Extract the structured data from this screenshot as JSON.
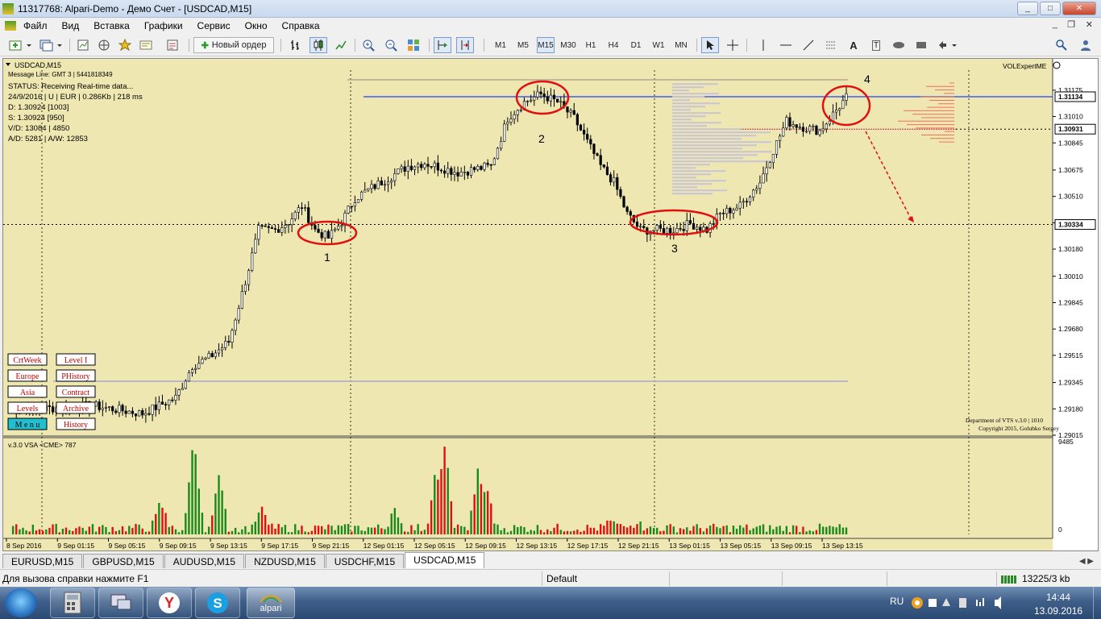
{
  "window": {
    "title": "11317768: Alpari-Demo - Демо Счет - [USDCAD,M15]",
    "buttons": [
      "_",
      "□",
      "✕"
    ]
  },
  "menu": [
    "Файл",
    "Вид",
    "Вставка",
    "Графики",
    "Сервис",
    "Окно",
    "Справка"
  ],
  "toolbar": {
    "new_order_label": "Новый ордер",
    "timeframes": [
      "M1",
      "M5",
      "M15",
      "M30",
      "H1",
      "H4",
      "D1",
      "W1",
      "MN"
    ],
    "active_timeframe": "M15"
  },
  "chart": {
    "symbol_title": "USDCAD,M15",
    "info_lines": [
      "Message Line: GMT 3 | 5441818349",
      "STATUS:  Receiving Real-time data...",
      "24/9/2016 | U | EUR | 0.286Kb | 218 ms",
      "D: 1.30924  [1003]",
      "S: 1.30924  [950]",
      "V/D: 13084 | 4850",
      "A/D: 5281 | A/W: 12853"
    ],
    "expert_label": "VOLExpertME",
    "copyright_lines": [
      "Department of VTS  v.3.0 | 1010",
      "Copyright 2015, Golubko Sergey"
    ],
    "side_buttons": [
      [
        "CrtWeek",
        "Level I"
      ],
      [
        "Europe",
        "PHistory"
      ],
      [
        "Asia",
        "Contract"
      ],
      [
        "Levels",
        "Archive"
      ],
      [
        "M e n u",
        "History"
      ]
    ],
    "annotations": [
      "1",
      "2",
      "3",
      "4"
    ],
    "indicator_label": "v.3.0 VSA <CME> 787"
  },
  "chart_data": {
    "type": "candlestick",
    "symbol": "USDCAD",
    "timeframe": "M15",
    "y_ticks": [
      "1.31175",
      "1.31010",
      "1.30845",
      "1.30675",
      "1.30510",
      "1.30345",
      "1.30180",
      "1.30010",
      "1.29845",
      "1.29680",
      "1.29515",
      "1.29345",
      "1.29180",
      "1.29015"
    ],
    "ylim": [
      1.2902,
      1.3125
    ],
    "price_labels": [
      "1.31134",
      "1.30931",
      "1.30334"
    ],
    "highlight_prices": {
      "blue": 1.31134,
      "red_dots": 1.30931,
      "black_dots": 1.30334
    },
    "x_ticks": [
      "8 Sep 2016",
      "9 Sep 01:15",
      "9 Sep 05:15",
      "9 Sep 09:15",
      "9 Sep 13:15",
      "9 Sep 17:15",
      "9 Sep 21:15",
      "12 Sep 01:15",
      "12 Sep 05:15",
      "12 Sep 09:15",
      "12 Sep 13:15",
      "12 Sep 17:15",
      "12 Sep 21:15",
      "13 Sep 01:15",
      "13 Sep 05:15",
      "13 Sep 09:15",
      "13 Sep 13:15"
    ],
    "close_path": [
      [
        1.2917,
        0
      ],
      [
        1.292,
        25
      ],
      [
        1.2915,
        40
      ],
      [
        1.2925,
        50
      ],
      [
        1.2945,
        55
      ],
      [
        1.295,
        60
      ],
      [
        1.296,
        66
      ],
      [
        1.299,
        70
      ],
      [
        1.303,
        75
      ],
      [
        1.303,
        80
      ],
      [
        1.3035,
        84
      ],
      [
        1.3045,
        88
      ],
      [
        1.303,
        92
      ],
      [
        1.3025,
        96
      ],
      [
        1.3035,
        100
      ],
      [
        1.305,
        104
      ],
      [
        1.3055,
        108
      ],
      [
        1.306,
        112
      ],
      [
        1.307,
        120
      ],
      [
        1.3072,
        125
      ],
      [
        1.3066,
        135
      ],
      [
        1.307,
        145
      ],
      [
        1.31,
        150
      ],
      [
        1.311,
        155
      ],
      [
        1.3115,
        160
      ],
      [
        1.311,
        165
      ],
      [
        1.31,
        170
      ],
      [
        1.3085,
        174
      ],
      [
        1.307,
        178
      ],
      [
        1.306,
        182
      ],
      [
        1.304,
        186
      ],
      [
        1.303,
        190
      ],
      [
        1.303,
        200
      ],
      [
        1.3034,
        205
      ],
      [
        1.303,
        210
      ],
      [
        1.304,
        214
      ],
      [
        1.3045,
        220
      ],
      [
        1.306,
        226
      ],
      [
        1.308,
        230
      ],
      [
        1.3098,
        234
      ],
      [
        1.3095,
        238
      ],
      [
        1.3092,
        244
      ],
      [
        1.3105,
        249
      ],
      [
        1.3113,
        252
      ]
    ],
    "volume_ylim": [
      0,
      9485
    ],
    "volume_labels": [
      "9485",
      "0"
    ],
    "volume_spikes": [
      {
        "pos": 0.18,
        "v": 3200,
        "c": "red"
      },
      {
        "pos": 0.22,
        "v": 9200,
        "c": "green"
      },
      {
        "pos": 0.25,
        "v": 5500,
        "c": "red"
      },
      {
        "pos": 0.3,
        "v": 2400,
        "c": "red"
      },
      {
        "pos": 0.46,
        "v": 2100,
        "c": "green"
      },
      {
        "pos": 0.52,
        "v": 9000,
        "c": "red"
      },
      {
        "pos": 0.51,
        "v": 6500,
        "c": "red"
      },
      {
        "pos": 0.56,
        "v": 6300,
        "c": "green"
      },
      {
        "pos": 0.57,
        "v": 4500,
        "c": "green"
      },
      {
        "pos": 0.72,
        "v": 1400,
        "c": "green"
      },
      {
        "pos": 0.75,
        "v": 900,
        "c": "red"
      }
    ]
  },
  "tabs": [
    "EURUSD,M15",
    "GBPUSD,M15",
    "AUDUSD,M15",
    "NZDUSD,M15",
    "USDCHF,M15",
    "USDCAD,M15"
  ],
  "active_tab": "USDCAD,M15",
  "status": {
    "help": "Для вызова справки нажмите F1",
    "profile": "Default",
    "traffic": "13225/3 kb"
  },
  "taskbar": {
    "lang": "RU",
    "time": "14:44",
    "date": "13.09.2016",
    "alpari_label": "alpari"
  },
  "colors": {
    "chart_bg": "#efe7b2",
    "candles": "#000000",
    "blue_line": "#1f3fff",
    "red_marks": "#e01010",
    "vol_up": "#1a8a1a",
    "vol_down": "#e01010",
    "button_text": "#c00000",
    "menu_button_bg": "#20c0d0"
  }
}
